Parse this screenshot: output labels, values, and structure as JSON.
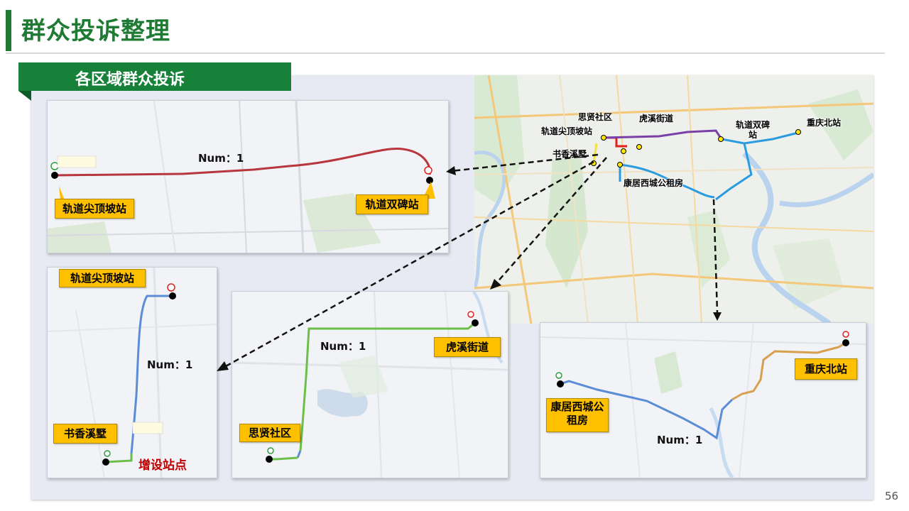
{
  "header": {
    "title": "群众投诉整理"
  },
  "section": {
    "label": "各区域群众投诉"
  },
  "overview_map": {
    "labels": {
      "sixian": "思贤社区",
      "huxi": "虎溪街道",
      "guidaojianding": "轨道尖顶坡站",
      "guidaoshuangbei": "轨道双碑站",
      "chongqingbei": "重庆北站",
      "shuxiang": "书香溪墅",
      "kangju": "康居西城公租房"
    }
  },
  "panels": {
    "top_left": {
      "start": "轨道尖顶坡站",
      "end": "轨道双碑站",
      "num": "Num：1"
    },
    "bottom_left": {
      "start": "轨道尖顶坡站",
      "end": "书香溪墅",
      "num": "Num：1",
      "note": "增设站点"
    },
    "bottom_middle": {
      "start": "思贤社区",
      "end": "虎溪街道",
      "num": "Num：1"
    },
    "bottom_right": {
      "start": "康居西城公租房",
      "end": "重庆北站",
      "num": "Num：1"
    }
  },
  "colors": {
    "accent_green": "#1f7a34",
    "callout": "#ffc000",
    "route_red": "#b5333a",
    "route_blue": "#5b8dd6",
    "route_green": "#6cc04a",
    "route_orange": "#d7a04f"
  },
  "page_number": "56"
}
